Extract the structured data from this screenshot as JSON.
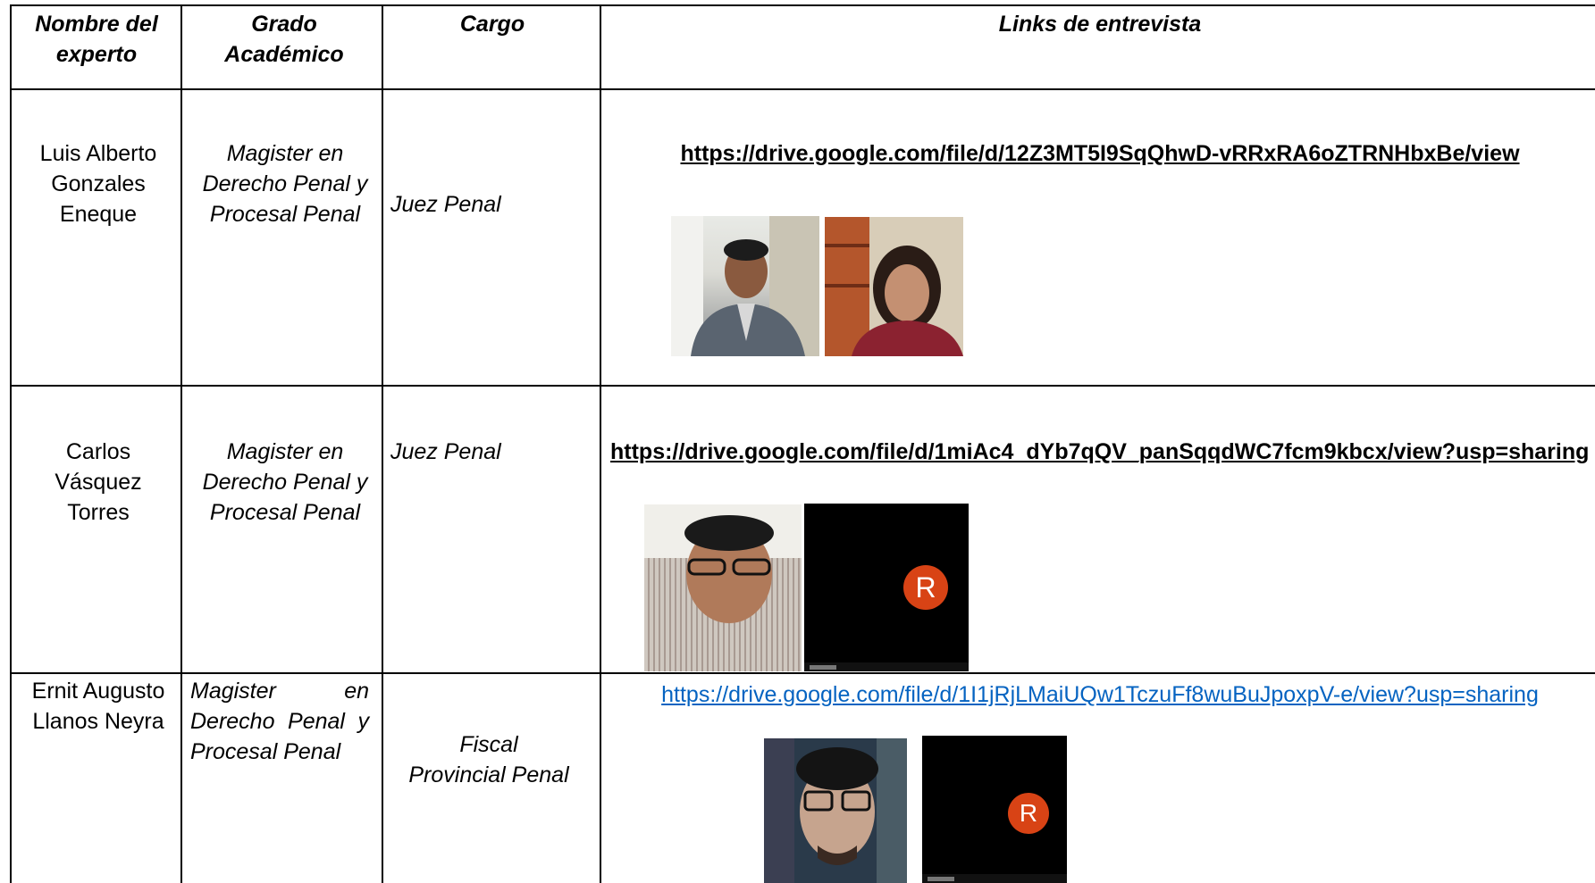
{
  "headers": {
    "nombre": "Nombre del experto",
    "grado": "Grado Académico",
    "cargo": "Cargo",
    "links": "Links de entrevista"
  },
  "rows": [
    {
      "nombre": "Luis Alberto Gonzales Eneque",
      "grado": "Magister en Derecho Penal y Procesal Penal",
      "cargo": "Juez Penal",
      "link": "https://drive.google.com/file/d/12Z3MT5I9SqQhwD-vRRxRA6oZTRNHbxBe/view"
    },
    {
      "nombre": "Carlos Vásquez Torres",
      "grado": "Magister en Derecho Penal y Procesal Penal",
      "cargo": "Juez Penal",
      "link": "https://drive.google.com/file/d/1miAc4_dYb7qQV_panSqqdWC7fcm9kbcx/view?usp=sharing",
      "avatar_letter": "R"
    },
    {
      "nombre": "Ernit Augusto Llanos Neyra",
      "grado_line1_a": "Magister",
      "grado_line1_b": "en",
      "grado_line2": "Derecho Penal y",
      "grado_line3": "Procesal Penal",
      "cargo": "Fiscal Provincial Penal",
      "link": "https://drive.google.com/file/d/1I1jRjLMaiUQw1TczuFf8wuBuJpoxpV-e/view?usp=sharing",
      "avatar_letter": "R"
    }
  ],
  "colors": {
    "link_blue": "#0563c1",
    "avatar_orange": "#d84315"
  }
}
